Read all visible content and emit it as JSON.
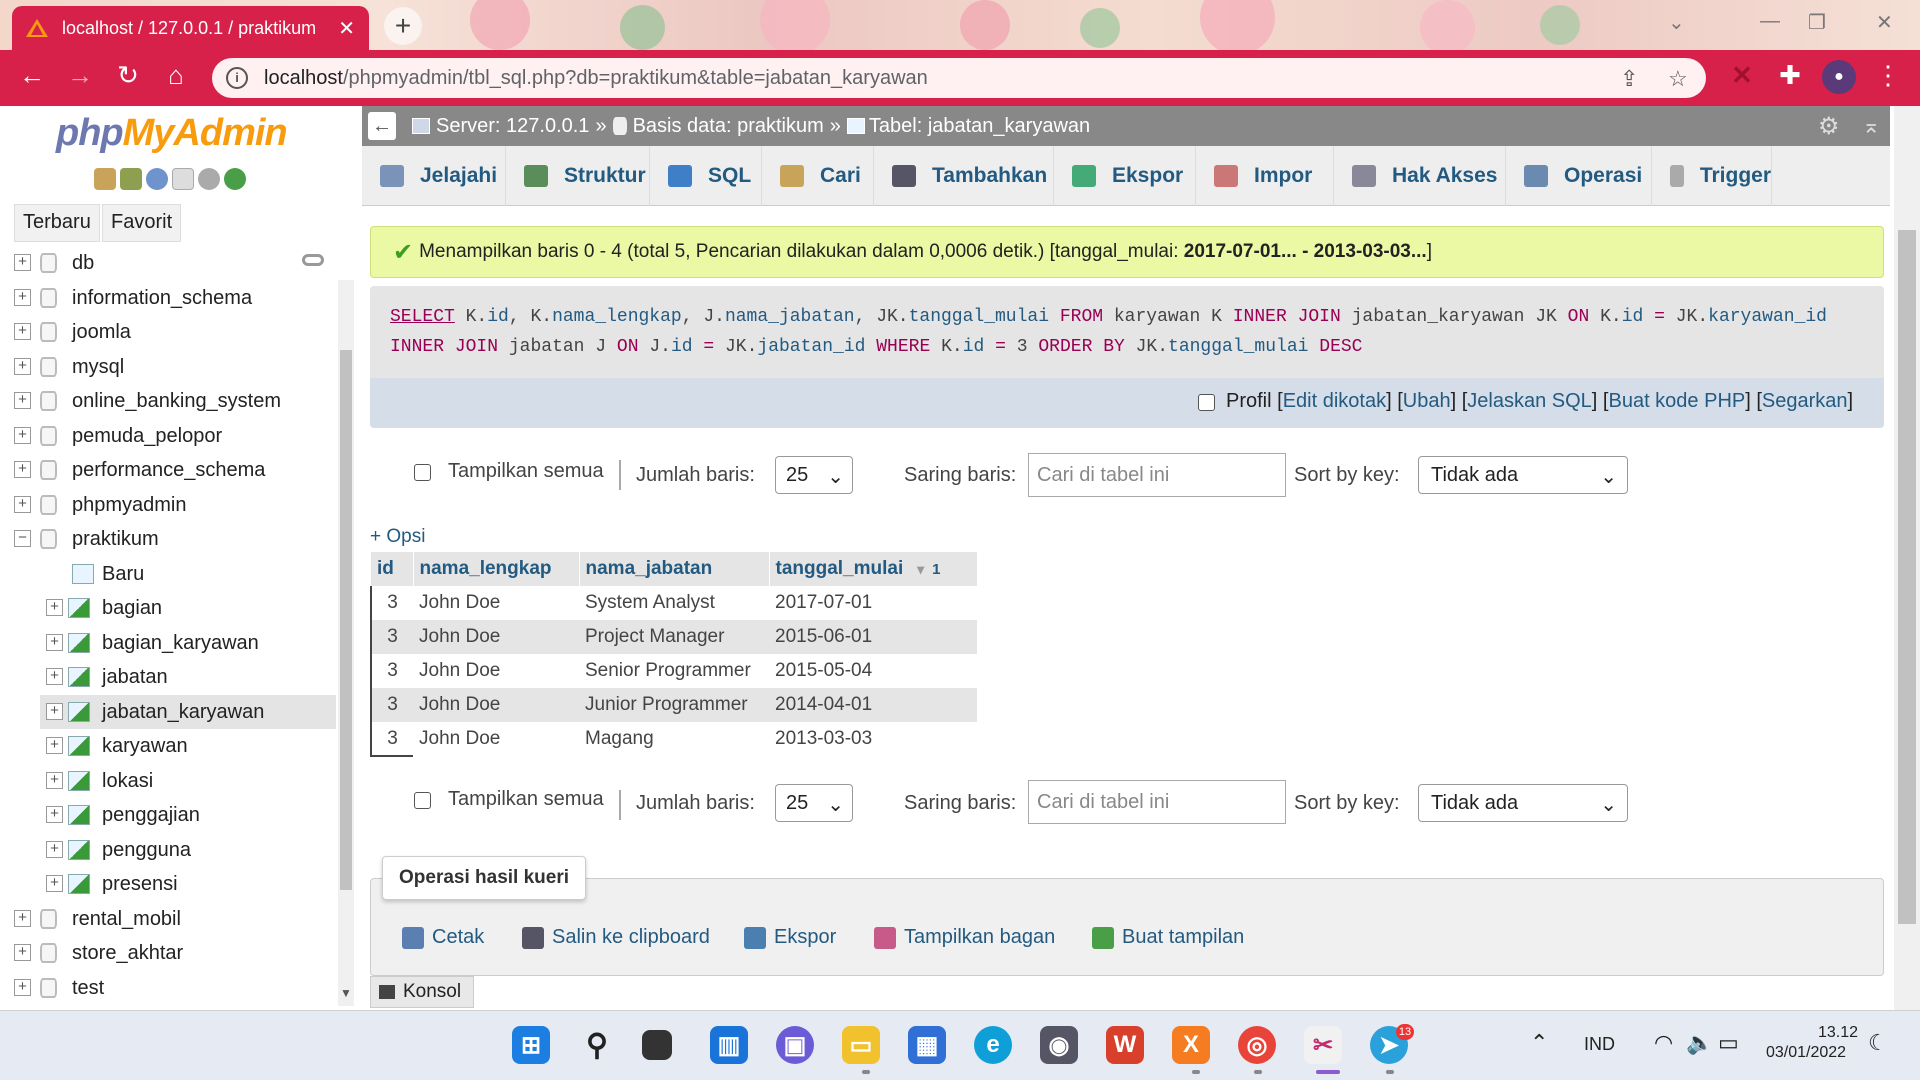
{
  "browser": {
    "tab_title": "localhost / 127.0.0.1 / praktikum",
    "url_host": "localhost",
    "url_path": "/phpmyadmin/tbl_sql.php?db=praktikum&table=jabatan_karyawan"
  },
  "sidebar": {
    "logo_php": "php",
    "logo_myadmin": "MyAdmin",
    "btn_recent": "Terbaru",
    "btn_favorite": "Favorit",
    "databases_top": [
      "db",
      "information_schema",
      "joomla",
      "mysql",
      "online_banking_system",
      "pemuda_pelopor",
      "performance_schema",
      "phpmyadmin",
      "praktikum"
    ],
    "praktikum_children": [
      "Baru",
      "bagian",
      "bagian_karyawan",
      "jabatan",
      "jabatan_karyawan",
      "karyawan",
      "lokasi",
      "penggajian",
      "pengguna",
      "presensi"
    ],
    "databases_bottom": [
      "rental_mobil",
      "store_akhtar",
      "test"
    ],
    "selected": "jabatan_karyawan"
  },
  "breadcrumb": {
    "server": "Server: 127.0.0.1",
    "database": "Basis data: praktikum",
    "table": "Tabel: jabatan_karyawan"
  },
  "menu": [
    "Jelajahi",
    "Struktur",
    "SQL",
    "Cari",
    "Tambahkan",
    "Ekspor",
    "Impor",
    "Hak Akses",
    "Operasi",
    "Trigger"
  ],
  "message": {
    "prefix": "Menampilkan baris 0 - 4 (total 5, Pencarian dilakukan dalam 0,0006 detik.) [tanggal_mulai: ",
    "range": "2017-07-01... - 2013-03-03...",
    "suffix": "]"
  },
  "sql": {
    "line1": "SELECT K.id, K.nama_lengkap, J.nama_jabatan, JK.tanggal_mulai FROM karyawan K INNER JOIN jabatan_karyawan JK ON K.id = JK.karyawan_id",
    "line2": "INNER JOIN jabatan J ON J.id = JK.jabatan_id WHERE K.id = 3 ORDER BY JK.tanggal_mulai DESC",
    "profile_label": "Profil",
    "links": [
      "Edit dikotak",
      "Ubah",
      "Jelaskan SQL",
      "Buat kode PHP",
      "Segarkan"
    ]
  },
  "controls": {
    "show_all": "Tampilkan semua",
    "rows_label": "Jumlah baris:",
    "rows_value": "25",
    "filter_label": "Saring baris:",
    "filter_placeholder": "Cari di tabel ini",
    "sort_label": "Sort by key:",
    "sort_value": "Tidak ada"
  },
  "options_link": "+ Opsi",
  "table": {
    "columns": [
      "id",
      "nama_lengkap",
      "nama_jabatan",
      "tanggal_mulai"
    ],
    "sort_indicator": "1",
    "rows": [
      [
        "3",
        "John Doe",
        "System Analyst",
        "2017-07-01"
      ],
      [
        "3",
        "John Doe",
        "Project Manager",
        "2015-06-01"
      ],
      [
        "3",
        "John Doe",
        "Senior Programmer",
        "2015-05-04"
      ],
      [
        "3",
        "John Doe",
        "Junior Programmer",
        "2014-04-01"
      ],
      [
        "3",
        "John Doe",
        "Magang",
        "2013-03-03"
      ]
    ]
  },
  "query_ops": {
    "legend": "Operasi hasil kueri",
    "items": [
      "Cetak",
      "Salin ke clipboard",
      "Ekspor",
      "Tampilkan bagan",
      "Buat tampilan"
    ]
  },
  "console": "Konsol",
  "taskbar": {
    "lang": "IND",
    "time": "13.12",
    "date": "03/01/2022",
    "telegram_badge": "13"
  },
  "colors": {
    "browser_accent": "#d8214a",
    "link": "#235a81",
    "success_bg": "#ebf8a4"
  }
}
